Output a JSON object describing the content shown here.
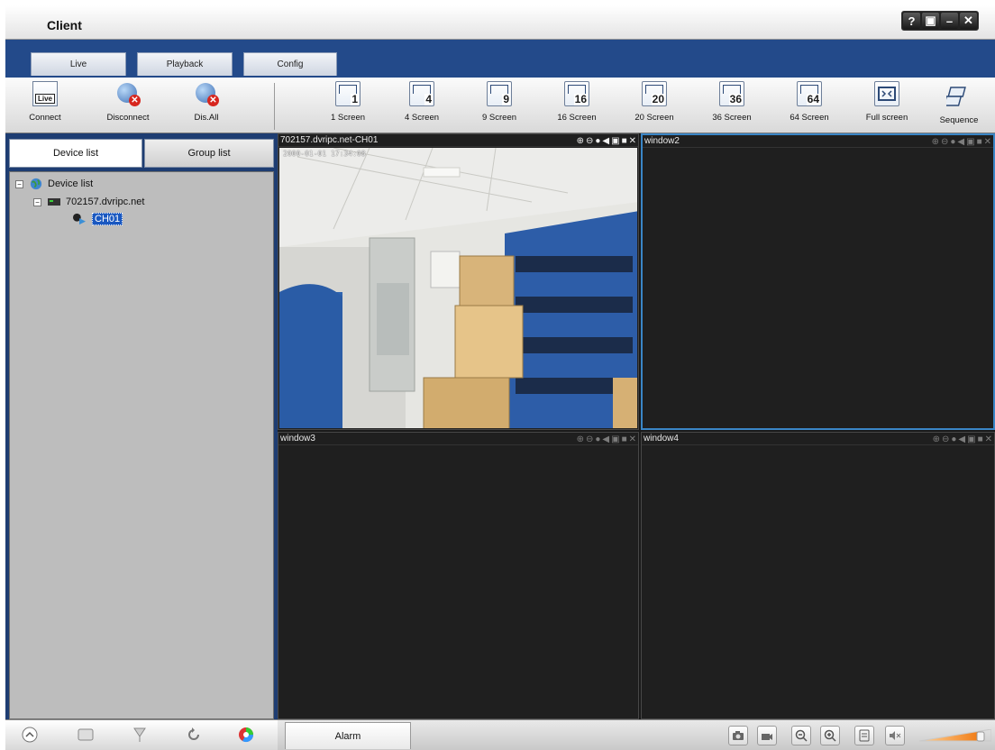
{
  "window": {
    "title": "Client",
    "buttons": [
      {
        "name": "help-icon",
        "glyph": "?"
      },
      {
        "name": "lock-icon",
        "glyph": "▣"
      },
      {
        "name": "minimize-icon",
        "glyph": "–"
      },
      {
        "name": "close-icon",
        "glyph": "✕"
      }
    ]
  },
  "tabs": [
    {
      "label": "Live",
      "active": true
    },
    {
      "label": "Playback",
      "active": false
    },
    {
      "label": "Config",
      "active": false
    }
  ],
  "toolbar": {
    "connect": {
      "label": "Connect",
      "icon": "live-icon"
    },
    "disconnect": {
      "label": "Disconnect",
      "icon": "disconnect-icon"
    },
    "disall": {
      "label": "Dis.All",
      "icon": "disconnect-all-icon"
    },
    "layouts": [
      {
        "label": "1 Screen",
        "num": "1"
      },
      {
        "label": "4 Screen",
        "num": "4"
      },
      {
        "label": "9 Screen",
        "num": "9"
      },
      {
        "label": "16 Screen",
        "num": "16"
      },
      {
        "label": "20 Screen",
        "num": "20"
      },
      {
        "label": "36 Screen",
        "num": "36"
      },
      {
        "label": "64 Screen",
        "num": "64"
      }
    ],
    "fullscreen": {
      "label": "Full screen",
      "icon": "fullscreen-icon"
    },
    "sequence": {
      "label": "Sequence",
      "icon": "sequence-icon"
    }
  },
  "left_panel": {
    "tabs": [
      "Device list",
      "Group list"
    ],
    "active_tab": "Device list",
    "tree": {
      "root": "Device list",
      "device": "702157.dvripc.net",
      "channel": "CH01"
    }
  },
  "video": {
    "windows": [
      {
        "title": "702157.dvripc.net-CH01",
        "osd": "2000-01-01  17:34:08",
        "has_feed": true
      },
      {
        "title": "window2",
        "selected": true
      },
      {
        "title": "window3"
      },
      {
        "title": "window4"
      }
    ]
  },
  "bottom": {
    "alarm_label": "Alarm",
    "buttons": [
      "camera-icon",
      "record-icon",
      "zoom-out-icon",
      "zoom-in-icon",
      "panel-icon",
      "mute-icon"
    ],
    "volume_level": 0.85
  },
  "colors": {
    "frame_blue": "#1f3f78",
    "selection": "#3a86c6",
    "video_bg": "#1f1f1f"
  }
}
